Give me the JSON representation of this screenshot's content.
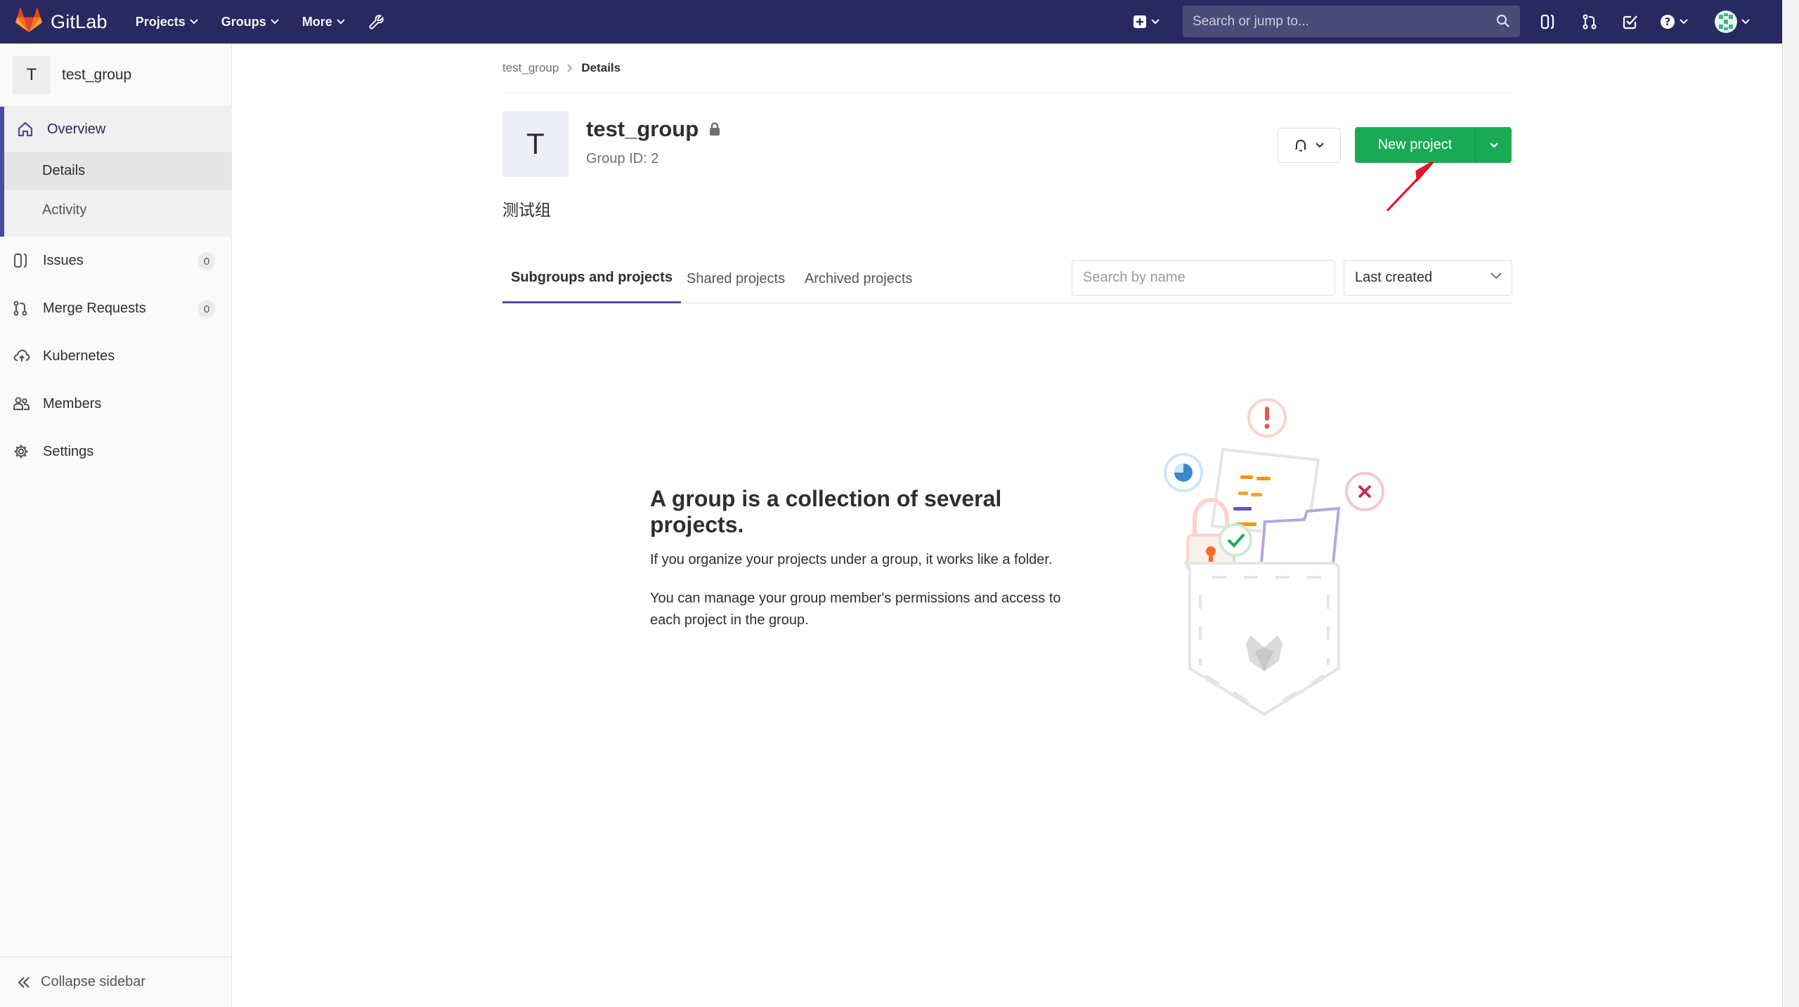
{
  "navbar": {
    "brand": "GitLab",
    "menu": [
      {
        "label": "Projects"
      },
      {
        "label": "Groups"
      },
      {
        "label": "More"
      }
    ],
    "search_placeholder": "Search or jump to...",
    "colors": {
      "bg": "#292961",
      "brand_orange": "#fc6d26"
    }
  },
  "sidebar": {
    "context_avatar": "T",
    "context_name": "test_group",
    "overview": {
      "label": "Overview",
      "sub": [
        {
          "label": "Details",
          "active": true
        },
        {
          "label": "Activity",
          "active": false
        }
      ]
    },
    "items": [
      {
        "label": "Issues",
        "icon": "issues-icon",
        "count": "0"
      },
      {
        "label": "Merge Requests",
        "icon": "merge-request-icon",
        "count": "0"
      },
      {
        "label": "Kubernetes",
        "icon": "cloud-icon"
      },
      {
        "label": "Members",
        "icon": "users-icon"
      },
      {
        "label": "Settings",
        "icon": "gear-icon"
      }
    ],
    "collapse_label": "Collapse sidebar"
  },
  "breadcrumb": {
    "parent": "test_group",
    "current": "Details"
  },
  "group": {
    "avatar_letter": "T",
    "name": "test_group",
    "id_text": "Group ID: 2",
    "description": "测试组",
    "new_project_label": "New project",
    "accent_green": "#1aaa55"
  },
  "tabs": [
    {
      "label": "Subgroups and projects",
      "active": true
    },
    {
      "label": "Shared projects",
      "active": false
    },
    {
      "label": "Archived projects",
      "active": false
    }
  ],
  "filter": {
    "search_placeholder": "Search by name",
    "sort_value": "Last created"
  },
  "empty_state": {
    "title": "A group is a collection of several projects.",
    "p1": "If you organize your projects under a group, it works like a folder.",
    "p2": "You can manage your group member's permissions and access to each project in the group."
  }
}
